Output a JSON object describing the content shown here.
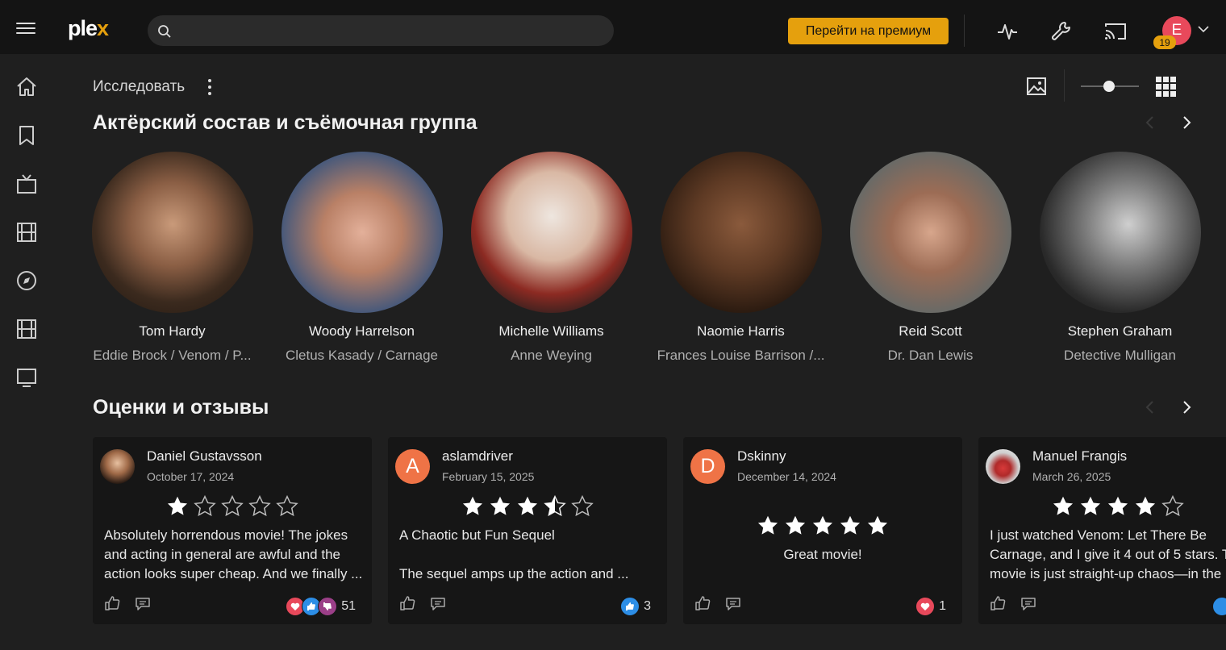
{
  "app": {
    "logo": "plex",
    "premium_label": "Перейти на премиум",
    "notifications": "19",
    "avatar_letter": "E"
  },
  "page": {
    "breadcrumb": "Исследовать"
  },
  "cast": {
    "title": "Актёрский состав и съёмочная группа",
    "people": [
      {
        "name": "Tom Hardy",
        "role": "Eddie Brock / Venom / P..."
      },
      {
        "name": "Woody Harrelson",
        "role": "Cletus Kasady / Carnage"
      },
      {
        "name": "Michelle Williams",
        "role": "Anne Weying"
      },
      {
        "name": "Naomie Harris",
        "role": "Frances Louise Barrison /..."
      },
      {
        "name": "Reid Scott",
        "role": "Dr. Dan Lewis"
      },
      {
        "name": "Stephen Graham",
        "role": "Detective Mulligan"
      }
    ]
  },
  "reviews": {
    "title": "Оценки и отзывы",
    "items": [
      {
        "author": "Daniel Gustavsson",
        "date": "October 17, 2024",
        "rating": 1,
        "title": "",
        "text": "Absolutely horrendous movie! The jokes and acting in general are awful and the action looks super cheap. And we finally ...",
        "reactions": [
          "heart",
          "thumbs-up",
          "thumbs-down"
        ],
        "count": "51"
      },
      {
        "author": "aslamdriver",
        "avatar_letter": "A",
        "date": "February 15, 2025",
        "rating": 3.5,
        "title": "A Chaotic but Fun Sequel",
        "text": "The sequel amps up the action and ...",
        "reactions": [
          "thumbs-up"
        ],
        "count": "3"
      },
      {
        "author": "Dskinny",
        "avatar_letter": "D",
        "date": "December 14, 2024",
        "rating": 5,
        "title": "Great movie!",
        "text": "",
        "reactions": [
          "heart"
        ],
        "count": "1"
      },
      {
        "author": "Manuel Frangis",
        "date": "March 26, 2025",
        "rating": 4,
        "title": "",
        "text": "I just watched Venom: Let There Be Carnage, and I give it 4 out of 5 stars. The movie is just straight-up chaos—in the ...",
        "reactions": [
          "thumbs-up"
        ],
        "count": ""
      }
    ]
  },
  "colors": {
    "accent": "#e5a00d",
    "background": "#1f1f1f",
    "topbar": "#141414",
    "card": "#161616",
    "heart": "#e8495b",
    "thumb": "#2d8ee6"
  }
}
